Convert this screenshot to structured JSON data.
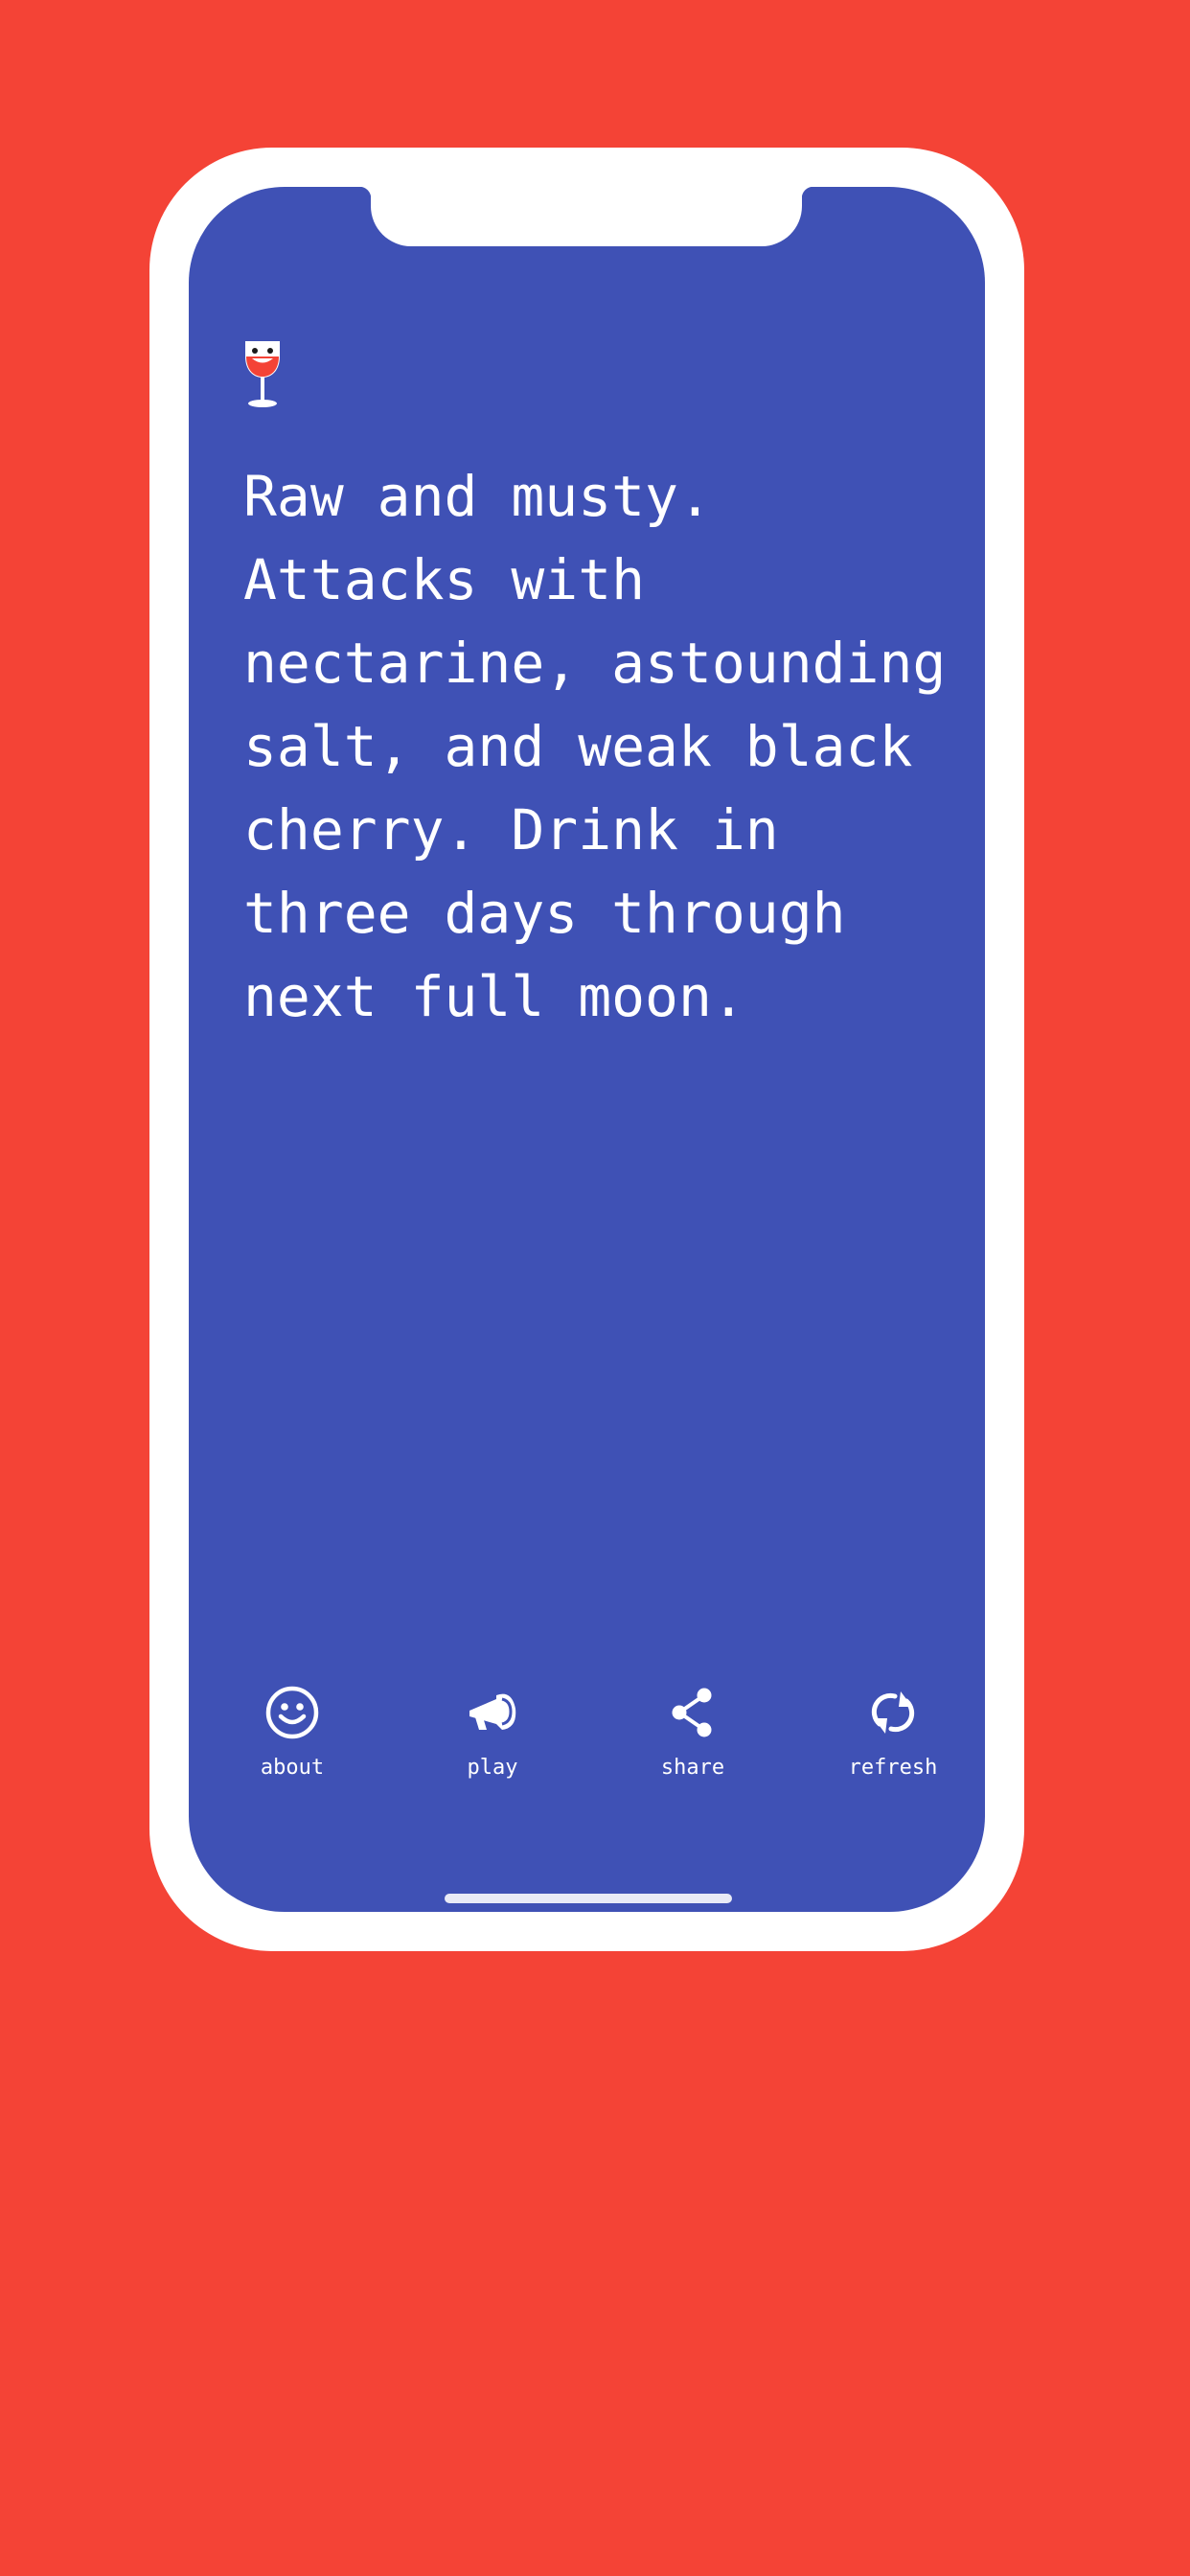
{
  "colors": {
    "background": "#F44336",
    "phone_frame": "#FFFFFF",
    "screen": "#3F51B5",
    "text": "#FFFFFF",
    "wine": "#F44336"
  },
  "header": {
    "icon": "wine-glass-face-icon"
  },
  "main": {
    "description": "Raw and musty. Attacks with nectarine, astounding salt, and weak black cherry. Drink in three days through next full moon."
  },
  "tabbar": {
    "items": [
      {
        "label": "about",
        "icon": "smiley-icon"
      },
      {
        "label": "play",
        "icon": "megaphone-icon"
      },
      {
        "label": "share",
        "icon": "share-icon"
      },
      {
        "label": "refresh",
        "icon": "refresh-icon"
      }
    ]
  }
}
